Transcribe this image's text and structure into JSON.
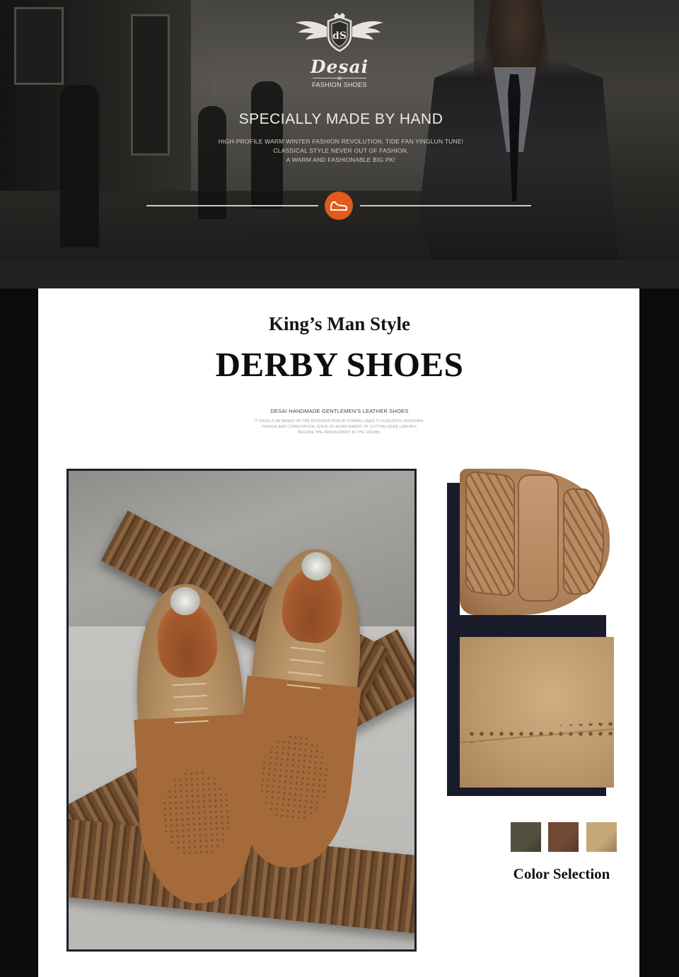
{
  "hero": {
    "brand": "Desai",
    "brand_sub": "FASHION SHOES",
    "title": "SPECIALLY MADE BY HAND",
    "lines": [
      "HIGH-PROFILE WARM WINTER FASHION REVOLUTION, TIDE FAN YINGLUN TUNE!",
      "CLASSICAL STYLE NEVER OUT OF FASHION,",
      "A WARM AND FASHIONABLE BIG PK!"
    ],
    "accent": "#e35a1c"
  },
  "product": {
    "subtitle": "King’s Man Style",
    "title": "DERBY SHOES",
    "desc_head": "DESAI HANDMADE GENTLEMEN'S LEATHER SHOES",
    "desc_lines": [
      "IT SHOULD BE BASED ON THE INTRODUCTION OF FORMAL LINES TO EXQUISITE FASHIONAL",
      "TORAGE AND CONNOTATION, ISSUE OF ACHIEVEMENT OF CUTTING-EDGE LOW-KEY,",
      "BECOME THE PROTAGONIST IN THE CROWD."
    ]
  },
  "colors": {
    "label": "Color Selection",
    "swatches": [
      {
        "name": "olive",
        "hex": "#54503f"
      },
      {
        "name": "brown",
        "hex": "#704a35"
      },
      {
        "name": "khaki",
        "hex": "#c6a878"
      }
    ]
  }
}
